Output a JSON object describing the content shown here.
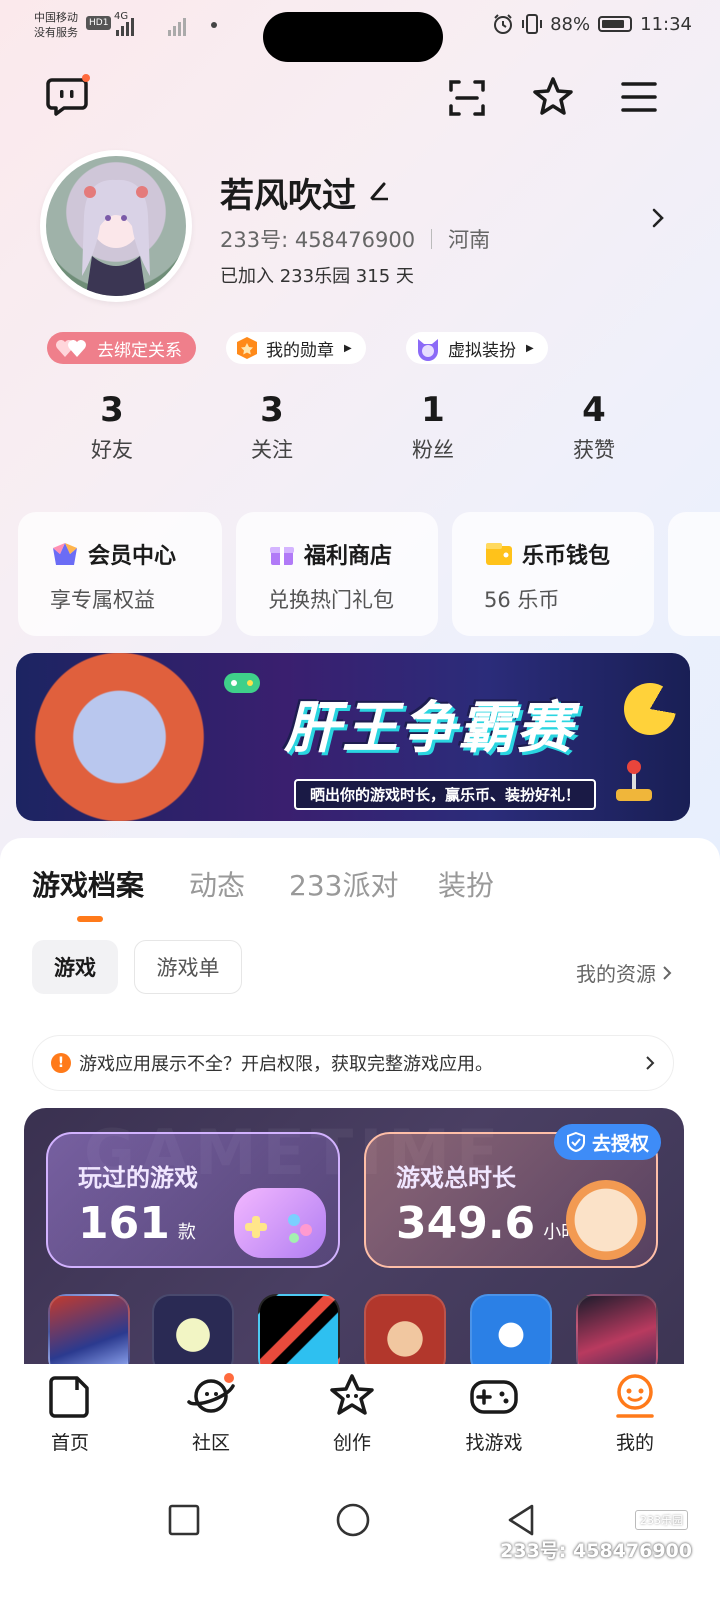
{
  "status_bar": {
    "carrier_line1": "中国移动",
    "carrier_line2": "没有服务",
    "hd_badge": "HD1",
    "network": "4G",
    "battery": "88%",
    "time": "11:34"
  },
  "header": {
    "icons": [
      "chat-icon",
      "scan-icon",
      "star-icon",
      "menu-icon"
    ]
  },
  "profile": {
    "name": "若风吹过",
    "id_text": "233号: 458476900",
    "region": "河南",
    "joined_text": "已加入 233乐园 315 天"
  },
  "chips": {
    "unbind": "去绑定关系",
    "badges": "我的勋章",
    "dressup": "虚拟装扮"
  },
  "stats": [
    {
      "value": "3",
      "label": "好友"
    },
    {
      "value": "3",
      "label": "关注"
    },
    {
      "value": "1",
      "label": "粉丝"
    },
    {
      "value": "4",
      "label": "获赞"
    }
  ],
  "cards": [
    {
      "title": "会员中心",
      "subtitle": "享专属权益"
    },
    {
      "title": "福利商店",
      "subtitle": "兑换热门礼包"
    },
    {
      "title": "乐币钱包",
      "subtitle": "56 乐币"
    }
  ],
  "banner": {
    "title": "肝王争霸赛",
    "subtitle": "晒出你的游戏时长，赢乐币、装扮好礼！"
  },
  "tabs": [
    "游戏档案",
    "动态",
    "233派对",
    "装扮"
  ],
  "segments": {
    "games": "游戏",
    "game_lists": "游戏单",
    "my_resources": "我的资源"
  },
  "notice": "游戏应用展示不全？开启权限，获取完整游戏应用。",
  "game_stats": {
    "bg_word": "GAMETIME",
    "played_label": "玩过的游戏",
    "played_value": "161",
    "played_unit": "款",
    "time_label": "游戏总时长",
    "time_value": "349.6",
    "time_unit": "小时",
    "auth_button": "去授权"
  },
  "bottom_nav": [
    {
      "label": "首页"
    },
    {
      "label": "社区"
    },
    {
      "label": "创作"
    },
    {
      "label": "找游戏"
    },
    {
      "label": "我的"
    }
  ],
  "watermark": {
    "logo": "233乐园",
    "text": "233号: 458476900"
  },
  "colors": {
    "accent": "#ff7a1a",
    "pink_chip": "#ef7f8b",
    "auth_blue": "#3e8cf7"
  }
}
